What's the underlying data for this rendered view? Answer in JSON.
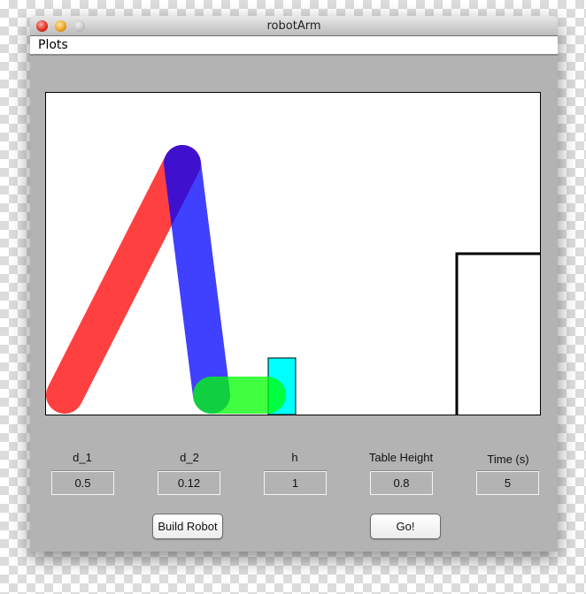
{
  "window": {
    "title": "robotArm"
  },
  "menu": {
    "items": [
      "Plots"
    ]
  },
  "plot": {
    "links": [
      {
        "name": "link-1",
        "color": "#ff0000"
      },
      {
        "name": "link-2",
        "color": "#0000ff"
      },
      {
        "name": "gripper",
        "color": "#00ff00"
      }
    ],
    "object_color": "#00ffff",
    "table_color": "#000000"
  },
  "params": [
    {
      "label": "d_1",
      "value": "0.5"
    },
    {
      "label": "d_2",
      "value": "0.12"
    },
    {
      "label": "h",
      "value": "1"
    },
    {
      "label": "Table Height",
      "value": "0.8"
    },
    {
      "label": "Time (s)",
      "value": "5"
    }
  ],
  "buttons": {
    "build": "Build Robot",
    "go": "Go!"
  }
}
